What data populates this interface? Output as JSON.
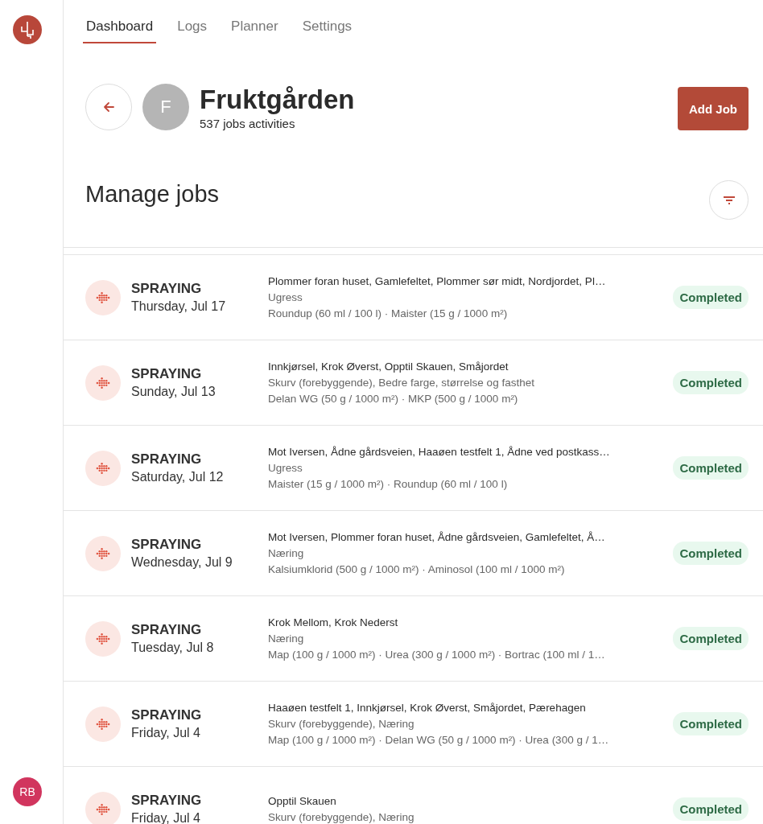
{
  "sidebar": {
    "user_initials": "RB"
  },
  "tabs": [
    {
      "label": "Dashboard",
      "selected": true
    },
    {
      "label": "Logs",
      "selected": false
    },
    {
      "label": "Planner",
      "selected": false
    },
    {
      "label": "Settings",
      "selected": false
    }
  ],
  "farm": {
    "avatar_letter": "F",
    "name": "Fruktgården",
    "subtitle": "537 jobs activities"
  },
  "add_button": "Add Job",
  "section_title": "Manage jobs",
  "jobs": [
    {
      "type": "SPRAYING",
      "date": "Thursday, Jul 17",
      "fields": "Plommer foran huset, Gamlefeltet, Plommer sør midt, Nordjordet, Pl…",
      "targets": "Ugress",
      "products": "Roundup (60 ml / 100 l) · Maister (15 g / 1000 m²)",
      "status": "Completed"
    },
    {
      "type": "SPRAYING",
      "date": "Sunday, Jul 13",
      "fields": "Innkjørsel, Krok Øverst, Opptil Skauen, Småjordet",
      "targets": "Skurv (forebyggende), Bedre farge, størrelse og fasthet",
      "products": "Delan WG (50 g / 1000 m²) · MKP (500 g / 1000 m²)",
      "status": "Completed"
    },
    {
      "type": "SPRAYING",
      "date": "Saturday, Jul 12",
      "fields": "Mot Iversen, Ådne gårdsveien, Haaøen testfelt 1, Ådne ved postkass…",
      "targets": "Ugress",
      "products": "Maister (15 g / 1000 m²) · Roundup (60 ml / 100 l)",
      "status": "Completed"
    },
    {
      "type": "SPRAYING",
      "date": "Wednesday, Jul 9",
      "fields": "Mot Iversen, Plommer foran huset, Ådne gårdsveien, Gamlefeltet, Å…",
      "targets": "Næring",
      "products": "Kalsiumklorid (500 g / 1000 m²) · Aminosol (100 ml / 1000 m²)",
      "status": "Completed"
    },
    {
      "type": "SPRAYING",
      "date": "Tuesday, Jul 8",
      "fields": "Krok Mellom, Krok Nederst",
      "targets": "Næring",
      "products": "Map (100 g / 1000 m²) · Urea (300 g / 1000 m²) · Bortrac (100 ml / 1…",
      "status": "Completed"
    },
    {
      "type": "SPRAYING",
      "date": "Friday, Jul 4",
      "fields": "Haaøen testfelt 1, Innkjørsel, Krok Øverst, Småjordet, Pærehagen",
      "targets": "Skurv (forebyggende), Næring",
      "products": "Map (100 g / 1000 m²) · Delan WG (50 g / 1000 m²) · Urea (300 g / 1…",
      "status": "Completed"
    },
    {
      "type": "SPRAYING",
      "date": "Friday, Jul 4",
      "fields": "Opptil Skauen",
      "targets": "Skurv (forebyggende), Næring",
      "status": "Completed"
    }
  ]
}
